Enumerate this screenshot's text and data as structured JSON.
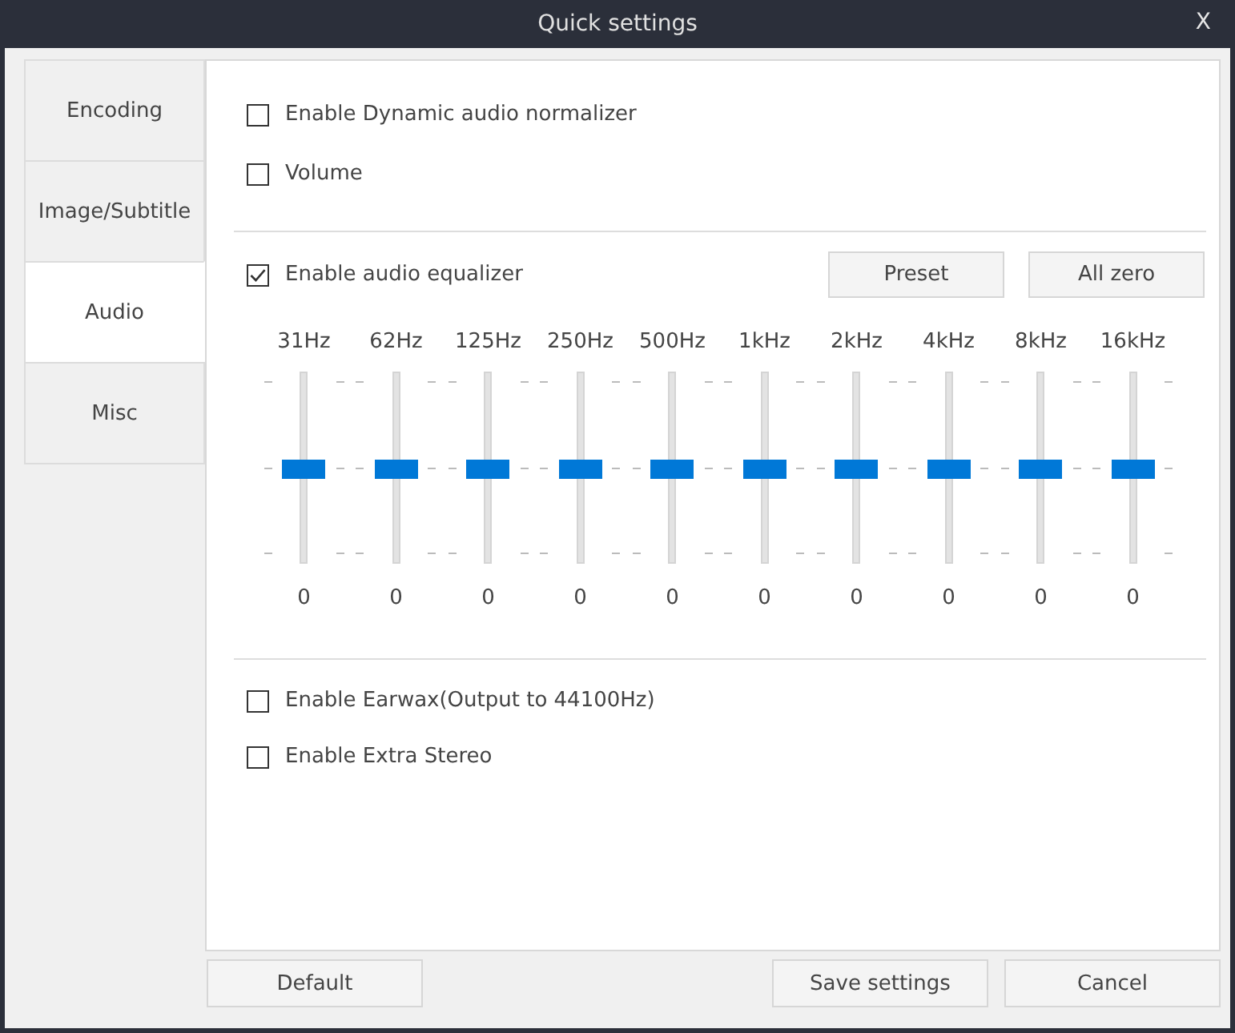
{
  "window": {
    "title": "Quick settings",
    "close": "X"
  },
  "tabs": [
    {
      "label": "Encoding",
      "selected": false
    },
    {
      "label": "Image/Subtitle",
      "selected": false
    },
    {
      "label": "Audio",
      "selected": true
    },
    {
      "label": "Misc",
      "selected": false
    }
  ],
  "options": [
    {
      "label": "Enable Dynamic audio normalizer",
      "checked": false
    },
    {
      "label": "Volume",
      "checked": false
    }
  ],
  "equalizer": {
    "label": "Enable audio equalizer",
    "checked": true,
    "buttons": [
      "Preset",
      "All zero"
    ],
    "bands": [
      {
        "label": "31Hz",
        "level": 0.5,
        "value": "0"
      },
      {
        "label": "62Hz",
        "level": 0.5,
        "value": "0"
      },
      {
        "label": "125Hz",
        "level": 0.5,
        "value": "0"
      },
      {
        "label": "250Hz",
        "level": 0.5,
        "value": "0"
      },
      {
        "label": "500Hz",
        "level": 0.5,
        "value": "0"
      },
      {
        "label": "1kHz",
        "level": 0.5,
        "value": "0"
      },
      {
        "label": "2kHz",
        "level": 0.5,
        "value": "0"
      },
      {
        "label": "4kHz",
        "level": 0.5,
        "value": "0"
      },
      {
        "label": "8kHz",
        "level": 0.5,
        "value": "0"
      },
      {
        "label": "16kHz",
        "level": 0.5,
        "value": "0"
      }
    ]
  },
  "extra_options": [
    {
      "label": "Enable Earwax(Output to 44100Hz)",
      "checked": false
    },
    {
      "label": "Enable Extra Stereo",
      "checked": false
    }
  ],
  "footer": {
    "left_button": "Default",
    "right_buttons": [
      "Save settings",
      "Cancel"
    ]
  }
}
